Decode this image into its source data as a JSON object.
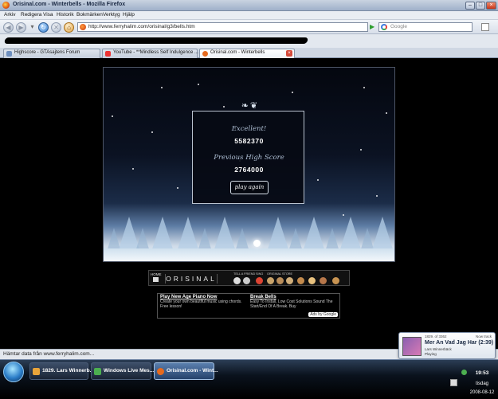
{
  "window": {
    "title": "Orisinal.com - Winterbells - Mozilla Firefox"
  },
  "menu": [
    "Arkiv",
    "Redigera",
    "Visa",
    "Historik",
    "Bokmärken",
    "Verktyg",
    "Hjälp"
  ],
  "nav": {
    "url": "http://www.ferryhalim.com/orisinal/g3/bells.htm",
    "search_placeholder": "Google"
  },
  "tabs": [
    {
      "label": "Highscore - GTAsajtens Forum",
      "active": false
    },
    {
      "label": "YouTube - **Mindless Self Indulgence ...",
      "active": false
    },
    {
      "label": "Orisinal.com - Winterbells",
      "active": true
    }
  ],
  "game": {
    "label1": "Excellent!",
    "score": "5582370",
    "label2": "Previous High Score",
    "high_score": "2764000",
    "play_again": "play again"
  },
  "orisinal_bar": {
    "home": "HOME",
    "logo": "ORISINAL",
    "tell_friend": "TELL A FRIEND",
    "sing": "SING",
    "store": "ORIGINAL STORE"
  },
  "ads": [
    {
      "title": "Play New Age Piano Now",
      "body": "Create your own beautiful music using chords. Free lesson!"
    },
    {
      "title": "Break Bells",
      "body": "Easy To Install, Low Cost Solutions Sound The Start/End Of A Break. Buy"
    }
  ],
  "ads_by": "Ads by Google",
  "status": "Hämtar data från www.ferryhalim.com...",
  "toast": {
    "track_no": "1829. of 3362",
    "label": "Now track",
    "song": "Mer An Vad Jag Har (2:39)",
    "artist": "Lars Winnerbäck",
    "state": "Playing"
  },
  "taskbar": {
    "items": [
      {
        "label": "1829. Lars Winnerb...",
        "active": false
      },
      {
        "label": "Windows Live Mes...",
        "active": false
      },
      {
        "label": "Orisinal.com - Wint...",
        "active": true
      }
    ],
    "time": "19:53",
    "day": "tisdag",
    "date": "2008-08-12"
  },
  "colors": {
    "taskbar": "#0a121d",
    "panel_border": "#b9c3d0",
    "score_text": "#ffffff"
  }
}
